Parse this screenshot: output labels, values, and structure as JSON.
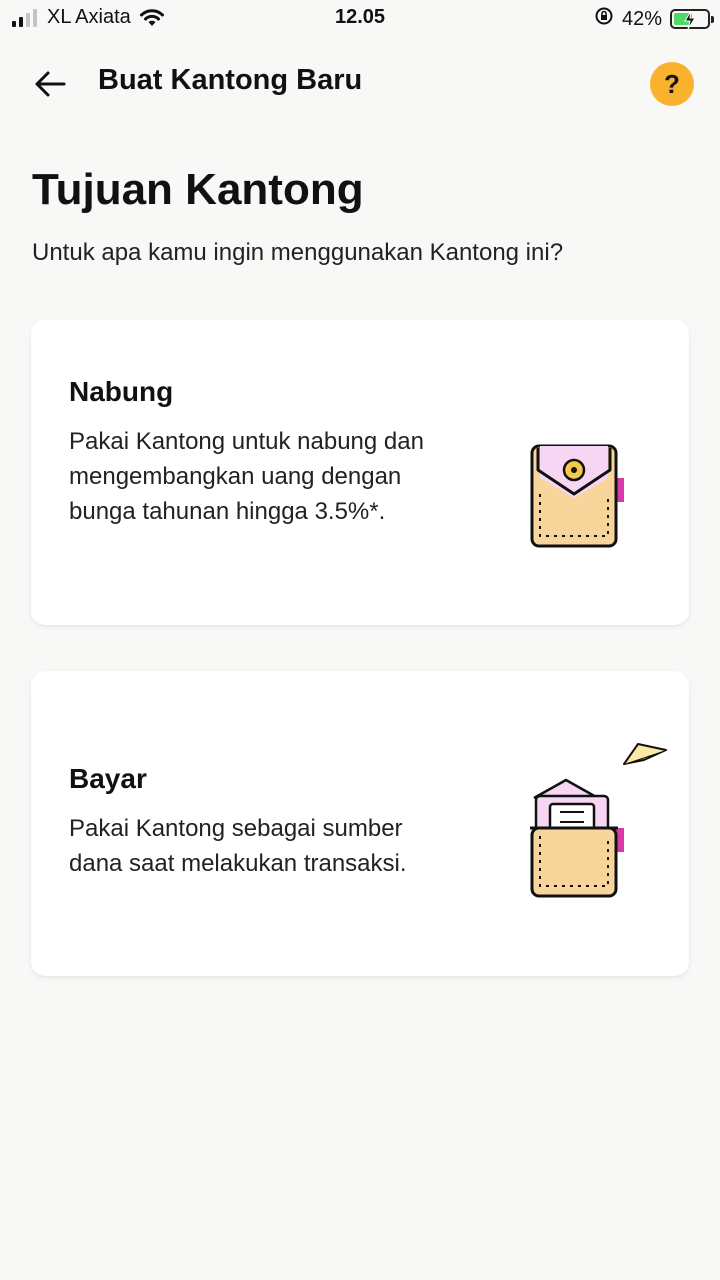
{
  "status_bar": {
    "carrier": "XL Axiata",
    "time": "12.05",
    "battery": "42%",
    "battery_level": 0.42,
    "icons": [
      "signal-icon",
      "wifi-icon",
      "orientation-lock-icon",
      "battery-charging-icon"
    ]
  },
  "header": {
    "title": "Buat Kantong Baru",
    "help_label": "?",
    "icons": [
      "back-arrow-icon"
    ]
  },
  "main": {
    "title": "Tujuan Kantong",
    "subtitle": "Untuk apa kamu ingin menggunakan Kantong ini?",
    "options": [
      {
        "title": "Nabung",
        "description": "Pakai Kantong untuk nabung dan mengembangkan uang dengan bunga tahunan hingga 3.5%*.",
        "icon": "savings-pocket-icon"
      },
      {
        "title": "Bayar",
        "description": "Pakai Kantong sebagai sumber dana saat melakukan transaksi.",
        "icon": "payment-pocket-icon"
      }
    ]
  },
  "colors": {
    "background": "#f8f8f7",
    "accent": "#f9b22d",
    "pocket": "#f8d59a",
    "pink": "#f6d6f2",
    "magenta": "#d93aa8"
  }
}
